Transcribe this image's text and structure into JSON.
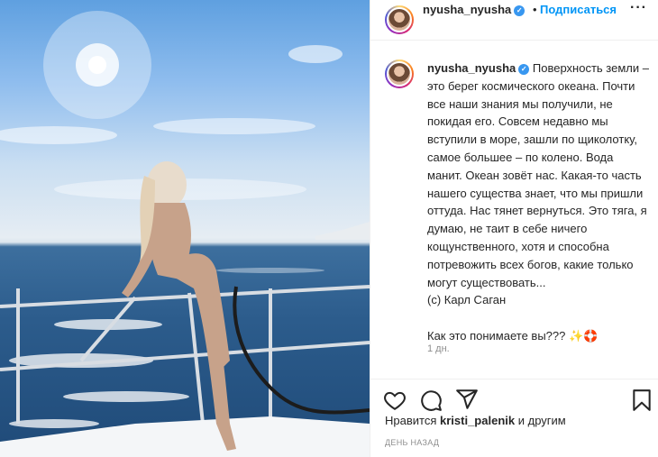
{
  "post": {
    "username": "nyusha_nyusha",
    "verified_mark": "✓",
    "follow_label": "Подписаться",
    "separator": "•",
    "more_label": "···",
    "caption": "Поверхность земли – это берег космического океана. Почти все наши знания мы получили, не покидая его. Совсем недавно мы вступили в море, зашли по щиколотку, самое большее – по колено. Вода манит. Океан зовёт нас. Какая-то часть нашего существа знает, что мы пришли оттуда. Нас тянет вернуться. Это тяга, я думаю, не таит в себе ничего кощунственного, хотя и способна потревожить всех богов, какие только могут существовать...\n(c) Карл Саган\n\nКак это понимаете вы???",
    "caption_emoji": "✨🛟",
    "comment_time": "1 дн.",
    "likes_prefix": "Нравится",
    "likes_user": "kristi_palenik",
    "likes_suffix": "и другим",
    "date": "ДЕНЬ НАЗАД"
  },
  "icons": {
    "like": "heart-icon",
    "comment": "comment-icon",
    "share": "share-icon",
    "save": "bookmark-icon",
    "verified": "verified-badge-icon"
  },
  "colors": {
    "accent": "#0095f6",
    "verified": "#3897f0",
    "text": "#262626",
    "muted": "#8e8e8e"
  }
}
